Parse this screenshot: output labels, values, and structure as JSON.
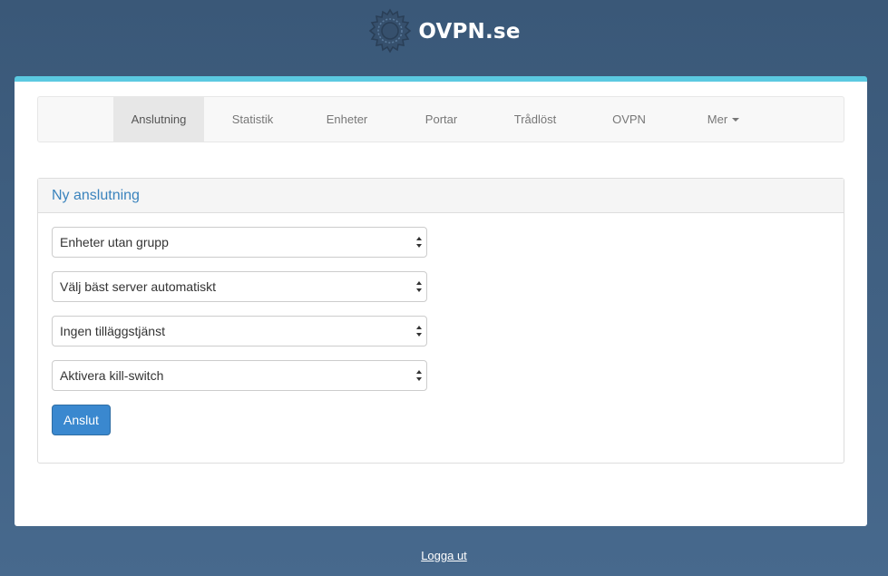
{
  "brand": {
    "name": "OVPN.se",
    "logo_icon": "gear-logo-icon"
  },
  "nav": {
    "items": [
      {
        "label": "Anslutning",
        "active": true
      },
      {
        "label": "Statistik",
        "active": false
      },
      {
        "label": "Enheter",
        "active": false
      },
      {
        "label": "Portar",
        "active": false
      },
      {
        "label": "Trådlöst",
        "active": false
      },
      {
        "label": "OVPN",
        "active": false
      },
      {
        "label": "Mer",
        "active": false,
        "dropdown": true
      }
    ]
  },
  "panel": {
    "title": "Ny anslutning",
    "selects": [
      {
        "value": "Enheter utan grupp"
      },
      {
        "value": "Välj bäst server automatiskt"
      },
      {
        "value": "Ingen tilläggstjänst"
      },
      {
        "value": "Aktivera kill-switch"
      }
    ],
    "connect_button": "Anslut"
  },
  "footer": {
    "logout_label": "Logga ut"
  },
  "colors": {
    "background": "#3f5f80",
    "accent_bar": "#5bc9e1",
    "primary_button": "#3a88cf",
    "panel_title": "#3a83bd"
  }
}
